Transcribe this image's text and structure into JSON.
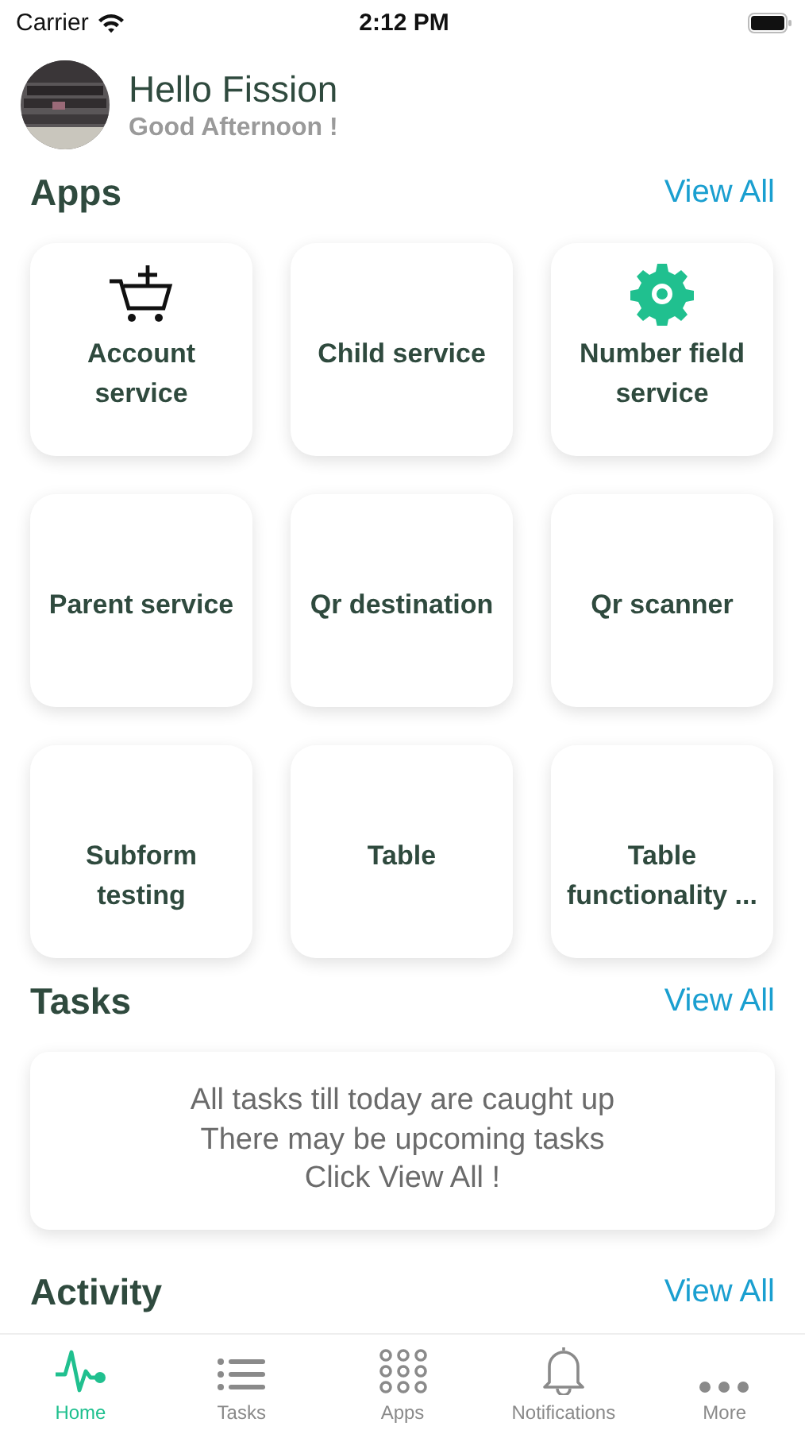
{
  "status_bar": {
    "carrier": "Carrier",
    "time": "2:12 PM"
  },
  "header": {
    "greeting": "Hello Fission",
    "subtitle": "Good Afternoon !"
  },
  "apps": {
    "title": "Apps",
    "view_all": "View All",
    "items": [
      {
        "label": "Account service",
        "kind": "cart"
      },
      {
        "label": "Child service",
        "kind": "plain"
      },
      {
        "label": "Number field service",
        "kind": "gear"
      },
      {
        "label": "Parent service",
        "kind": "plain"
      },
      {
        "label": "Qr destination",
        "kind": "plain"
      },
      {
        "label": "Qr scanner",
        "kind": "plain"
      },
      {
        "label": "Subform testing",
        "kind": "plain"
      },
      {
        "label": "Table",
        "kind": "plain"
      },
      {
        "label": "Table functionality ...",
        "kind": "plain"
      }
    ]
  },
  "tasks": {
    "title": "Tasks",
    "view_all": "View All",
    "message": [
      "All tasks till today are caught up",
      "There may be upcoming tasks",
      "Click View All !"
    ]
  },
  "activity": {
    "title": "Activity",
    "view_all": "View All"
  },
  "tab_bar": [
    {
      "label": "Home",
      "selected": true
    },
    {
      "label": "Tasks",
      "selected": false
    },
    {
      "label": "Apps",
      "selected": false
    },
    {
      "label": "Notifications",
      "selected": false
    },
    {
      "label": "More",
      "selected": false
    }
  ]
}
